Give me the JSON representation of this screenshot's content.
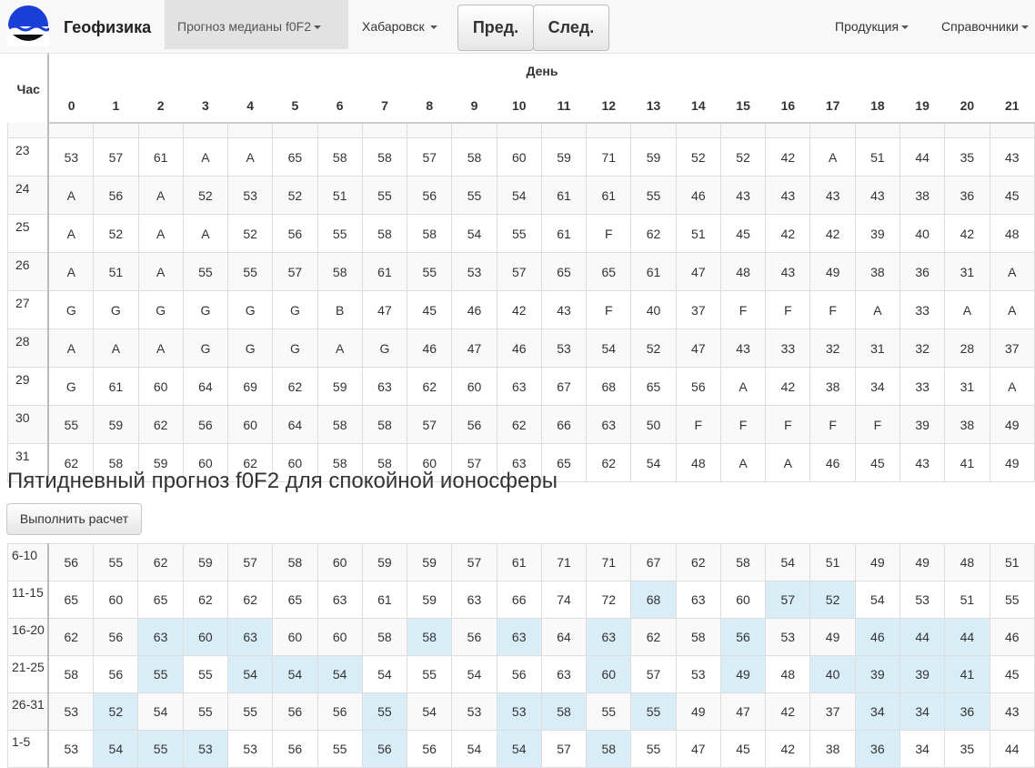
{
  "navbar": {
    "brand": "Геофизика",
    "menu_forecast": "Прогноз медианы f0F2",
    "menu_station": "Хабаровск",
    "btn_prev": "Пред.",
    "btn_next": "След.",
    "menu_products": "Продукция",
    "menu_reference": "Справочники"
  },
  "month_table": {
    "hour_label": "Час",
    "day_label": "День",
    "columns": [
      "0",
      "1",
      "2",
      "3",
      "4",
      "5",
      "6",
      "7",
      "8",
      "9",
      "10",
      "11",
      "12",
      "13",
      "14",
      "15",
      "16",
      "17",
      "18",
      "19",
      "20",
      "21"
    ],
    "rows": [
      {
        "label": "23",
        "cells": [
          "53",
          "57",
          "61",
          "A",
          "A",
          "65",
          "58",
          "58",
          "57",
          "58",
          "60",
          "59",
          "71",
          "59",
          "52",
          "52",
          "42",
          "A",
          "51",
          "44",
          "35",
          "43"
        ]
      },
      {
        "label": "24",
        "cells": [
          "A",
          "56",
          "A",
          "52",
          "53",
          "52",
          "51",
          "55",
          "56",
          "55",
          "54",
          "61",
          "61",
          "55",
          "46",
          "43",
          "43",
          "43",
          "43",
          "38",
          "36",
          "45"
        ]
      },
      {
        "label": "25",
        "cells": [
          "A",
          "52",
          "A",
          "A",
          "52",
          "56",
          "55",
          "58",
          "58",
          "54",
          "55",
          "61",
          "F",
          "62",
          "51",
          "45",
          "42",
          "42",
          "39",
          "40",
          "42",
          "48"
        ]
      },
      {
        "label": "26",
        "cells": [
          "A",
          "51",
          "A",
          "55",
          "55",
          "57",
          "58",
          "61",
          "55",
          "53",
          "57",
          "65",
          "65",
          "61",
          "47",
          "48",
          "43",
          "49",
          "38",
          "36",
          "31",
          "A"
        ]
      },
      {
        "label": "27",
        "cells": [
          "G",
          "G",
          "G",
          "G",
          "G",
          "G",
          "B",
          "47",
          "45",
          "46",
          "42",
          "43",
          "F",
          "40",
          "37",
          "F",
          "F",
          "F",
          "A",
          "33",
          "A",
          "A"
        ]
      },
      {
        "label": "28",
        "cells": [
          "A",
          "A",
          "A",
          "G",
          "G",
          "G",
          "A",
          "G",
          "46",
          "47",
          "46",
          "53",
          "54",
          "52",
          "47",
          "43",
          "33",
          "32",
          "31",
          "32",
          "28",
          "37"
        ]
      },
      {
        "label": "29",
        "cells": [
          "G",
          "61",
          "60",
          "64",
          "69",
          "62",
          "59",
          "63",
          "62",
          "60",
          "63",
          "67",
          "68",
          "65",
          "56",
          "A",
          "42",
          "38",
          "34",
          "33",
          "31",
          "A"
        ]
      },
      {
        "label": "30",
        "cells": [
          "55",
          "59",
          "62",
          "56",
          "60",
          "64",
          "58",
          "58",
          "57",
          "56",
          "62",
          "66",
          "63",
          "50",
          "F",
          "F",
          "F",
          "F",
          "F",
          "39",
          "38",
          "49"
        ]
      },
      {
        "label": "31",
        "cells": [
          "62",
          "58",
          "59",
          "60",
          "62",
          "60",
          "58",
          "58",
          "60",
          "57",
          "63",
          "65",
          "62",
          "54",
          "48",
          "A",
          "A",
          "46",
          "45",
          "43",
          "41",
          "49"
        ]
      }
    ]
  },
  "five_day": {
    "title": "Пятидневный прогноз f0F2 для спокойной ионосферы",
    "run_button": "Выполнить расчет",
    "rows": [
      {
        "label": "6-10",
        "cells": [
          "56",
          "55",
          "62",
          "59",
          "57",
          "58",
          "60",
          "59",
          "59",
          "57",
          "61",
          "71",
          "71",
          "67",
          "62",
          "58",
          "54",
          "51",
          "49",
          "49",
          "48",
          "51"
        ],
        "hl": []
      },
      {
        "label": "11-15",
        "cells": [
          "65",
          "60",
          "65",
          "62",
          "62",
          "65",
          "63",
          "61",
          "59",
          "63",
          "66",
          "74",
          "72",
          "68",
          "63",
          "60",
          "57",
          "52",
          "54",
          "53",
          "51",
          "55"
        ],
        "hl": [
          13,
          16,
          17
        ]
      },
      {
        "label": "16-20",
        "cells": [
          "62",
          "56",
          "63",
          "60",
          "63",
          "60",
          "60",
          "58",
          "58",
          "56",
          "63",
          "64",
          "63",
          "62",
          "58",
          "56",
          "53",
          "49",
          "46",
          "44",
          "44",
          "46"
        ],
        "hl": [
          2,
          3,
          4,
          8,
          10,
          12,
          15,
          18,
          19,
          20
        ]
      },
      {
        "label": "21-25",
        "cells": [
          "58",
          "56",
          "55",
          "55",
          "54",
          "54",
          "54",
          "54",
          "55",
          "54",
          "56",
          "63",
          "60",
          "57",
          "53",
          "49",
          "48",
          "40",
          "39",
          "39",
          "41",
          "45"
        ],
        "hl": [
          2,
          4,
          5,
          6,
          12,
          15,
          17,
          18,
          19,
          20
        ]
      },
      {
        "label": "26-31",
        "cells": [
          "53",
          "52",
          "54",
          "55",
          "55",
          "56",
          "56",
          "55",
          "54",
          "53",
          "53",
          "58",
          "55",
          "55",
          "49",
          "47",
          "42",
          "37",
          "34",
          "34",
          "36",
          "43"
        ],
        "hl": [
          1,
          7,
          10,
          11,
          13,
          18,
          19,
          20
        ]
      },
      {
        "label": "1-5",
        "cells": [
          "53",
          "54",
          "55",
          "53",
          "53",
          "56",
          "55",
          "56",
          "56",
          "54",
          "54",
          "57",
          "58",
          "55",
          "47",
          "45",
          "42",
          "38",
          "36",
          "34",
          "35",
          "44"
        ],
        "hl": [
          1,
          2,
          3,
          7,
          10,
          12,
          18
        ]
      }
    ]
  },
  "colors": {
    "highlight": "#d9edf7",
    "navbar_bg": "#f8f8f8",
    "logo_blue": "#1a3fd8"
  }
}
